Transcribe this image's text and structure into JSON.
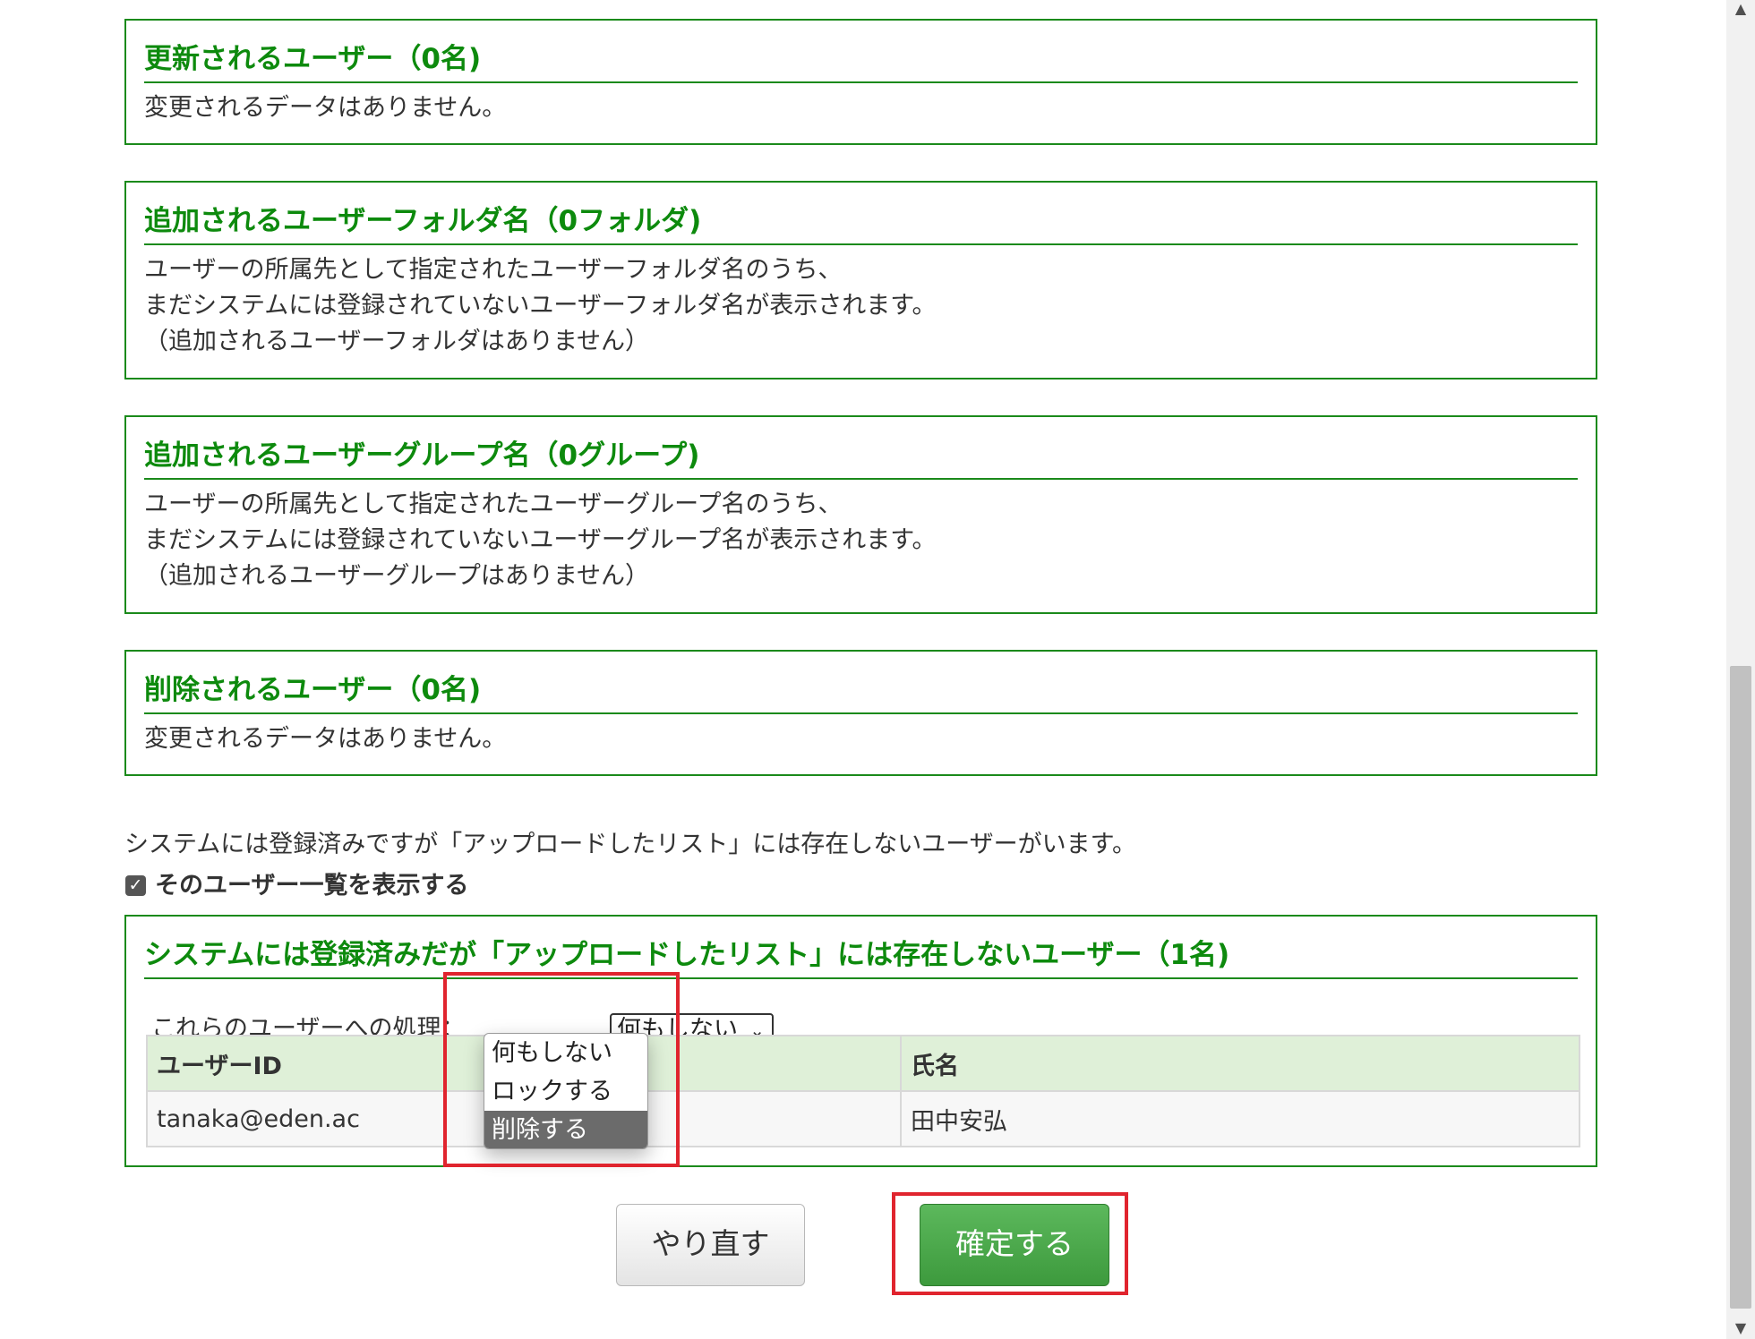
{
  "sections": {
    "updated_users": {
      "title": "更新されるユーザー（0名)",
      "lines": [
        "変更されるデータはありません。"
      ]
    },
    "added_folders": {
      "title": "追加されるユーザーフォルダ名（0フォルダ)",
      "lines": [
        "ユーザーの所属先として指定されたユーザーフォルダ名のうち、",
        "まだシステムには登録されていないユーザーフォルダ名が表示されます。",
        "（追加されるユーザーフォルダはありません）"
      ]
    },
    "added_groups": {
      "title": "追加されるユーザーグループ名（0グループ)",
      "lines": [
        "ユーザーの所属先として指定されたユーザーグループ名のうち、",
        "まだシステムには登録されていないユーザーグループ名が表示されます。",
        "（追加されるユーザーグループはありません）"
      ]
    },
    "deleted_users": {
      "title": "削除されるユーザー（0名)",
      "lines": [
        "変更されるデータはありません。"
      ]
    }
  },
  "notice": "システムには登録済みですが「アップロードしたリスト」には存在しないユーザーがいます。",
  "show_list_checkbox": {
    "label": "そのユーザー一覧を表示する",
    "checked": true
  },
  "missing_users": {
    "title": "システムには登録済みだが「アップロードしたリスト」には存在しないユーザー（1名)",
    "action_label": "これらのユーザーへの処理：",
    "action_selected": "何もしない",
    "action_options": [
      "何もしない",
      "ロックする",
      "削除する"
    ],
    "action_highlighted": "削除する",
    "columns": [
      "ユーザーID",
      "氏名"
    ],
    "rows": [
      [
        "tanaka@eden.ac",
        "田中安弘"
      ]
    ]
  },
  "buttons": {
    "redo": "やり直す",
    "confirm": "確定する"
  },
  "colors": {
    "section_green": "#1b8a1b",
    "header_bg": "#dff0d8",
    "confirm_green": "#4cae4c",
    "highlight_red": "#e0242e"
  }
}
